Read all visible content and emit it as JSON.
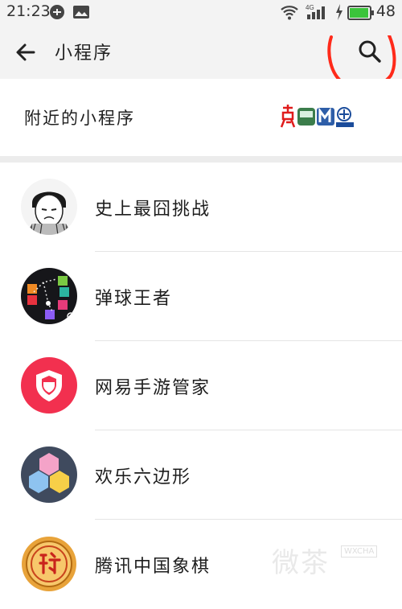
{
  "status_bar": {
    "time": "21:23",
    "network": "4G",
    "battery_level": "48",
    "battery_fill_fraction": 0.48,
    "icons": [
      "notification-icon",
      "image-icon",
      "wifi-icon",
      "signal-icon",
      "charging-icon",
      "battery-icon"
    ]
  },
  "header": {
    "title": "小程序",
    "back_icon": "back-arrow-icon",
    "search_icon": "search-icon",
    "annotation_color": "#ff2a1a"
  },
  "nearby": {
    "label": "附近的小程序"
  },
  "items": [
    {
      "name": "史上最囧挑战",
      "icon": "meme-face-icon"
    },
    {
      "name": "弹球王者",
      "icon": "ball-game-icon"
    },
    {
      "name": "网易手游管家",
      "icon": "shield-icon"
    },
    {
      "name": "欢乐六边形",
      "icon": "hexagon-icon"
    },
    {
      "name": "腾讯中国象棋",
      "icon": "chess-piece-icon"
    }
  ],
  "watermark": {
    "text": "微茶",
    "sub": "WXCHA"
  },
  "colors": {
    "header_bg": "#f3f3f3",
    "shield_red": "#f2304f",
    "hex_bg": "#3f4a5e"
  }
}
